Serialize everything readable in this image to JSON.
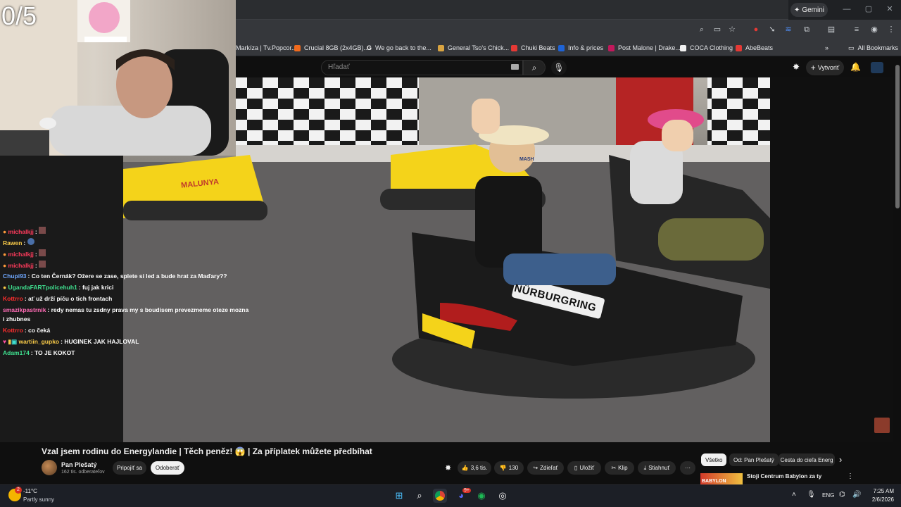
{
  "browser": {
    "gemini_label": "Gemini",
    "bookmarks": [
      {
        "label": "Markíza | Tv.Popcor...",
        "color": "#e8eaed"
      },
      {
        "label": "Crucial 8GB (2x4GB)...",
        "color": "#f06a1d"
      },
      {
        "label": "We go back to the...",
        "color": "#4285f4"
      },
      {
        "label": "General Tso's Chick...",
        "color": "#d9a441"
      },
      {
        "label": "Chuki Beats",
        "color": "#e53935"
      },
      {
        "label": "Info & prices",
        "color": "#1e63d6"
      },
      {
        "label": "Post Malone | Drake...",
        "color": "#c2185b"
      },
      {
        "label": "COCA Clothing",
        "color": "#f1f1f1"
      },
      {
        "label": "AbeBeats",
        "color": "#e53935"
      }
    ],
    "all_bookmarks_label": "All Bookmarks",
    "more_bookmarks_label": "»"
  },
  "youtube": {
    "search_placeholder": "Hľadať",
    "create_label": "Vytvoriť",
    "video_title": "Vzal jsem rodinu do Energylandie | Těch peněz! 😱 | Za příplatek můžete předbíhat",
    "channel_name": "Pan Plešatý",
    "subscribers": "162 tis. odberateľov",
    "join_label": "Pripojiť sa",
    "unsubscribe_label": "Odoberať",
    "likes": "3,6 tis.",
    "dislikes": "130",
    "share_label": "Zdieľať",
    "save_label": "Uložiť",
    "clip_label": "Klip",
    "download_label": "Stiahnuť",
    "more_label": "···",
    "chips": [
      "Všetko",
      "Od: Pan Plešatý",
      "Cesta do cieľa Energ"
    ],
    "chip_next": "›",
    "reco_title": "Stoji Centrum Babylon za ty",
    "reco_thumb_text": "BABYLON LIBEREC"
  },
  "stream": {
    "counter": "0/5",
    "chat": [
      {
        "name": "michalkjj",
        "name_color": "#ff3b5c",
        "message": ""
      },
      {
        "name": "Rawen",
        "name_color": "#f7c948",
        "message": ""
      },
      {
        "name": "michalkjj",
        "name_color": "#ff3b5c",
        "message": ""
      },
      {
        "name": "michalkjj",
        "name_color": "#ff3b5c",
        "message": ""
      },
      {
        "name": "Chupi93",
        "name_color": "#6fa8ff",
        "message": "Co ten Černák? Ožere se zase, splete si led a bude hrat za Maďary??"
      },
      {
        "name": "UgandaFARTpolicehuh1",
        "name_color": "#3fe08f",
        "message": "fuj jak krici"
      },
      {
        "name": "Kottrro",
        "name_color": "#ff2d2d",
        "message": "ať už drží píču o tich frontach"
      },
      {
        "name": "smazikpastrnik",
        "name_color": "#ff6bb5",
        "message": "redy nemas tu zsdny prava my s boudisem prevezmeme oteze mozna"
      },
      {
        "name": "",
        "name_color": "#ffffff",
        "message": "i zhubnes"
      },
      {
        "name": "Kottrro",
        "name_color": "#ff2d2d",
        "message": "co čeká"
      },
      {
        "name": "wartiin_gupko",
        "name_color": "#f7c948",
        "message": "HUGINEK JAK HAJLOVAL"
      },
      {
        "name": "Adam174",
        "name_color": "#3fe08f",
        "message": "TO JE KOKOT"
      }
    ]
  },
  "video_scene": {
    "car_labels": [
      "MALUNYA",
      "NÜRBURGRING",
      "MASH"
    ]
  },
  "taskbar": {
    "weather_temp": "-11°C",
    "weather_desc": "Partly sunny",
    "notification_badge": "2",
    "discord_badge": "9+",
    "language": "ENG",
    "time": "7:25 AM",
    "date": "2/6/2026"
  },
  "colors": {
    "yt_bg": "#0f0f0f",
    "chrome_toolbar": "#35373b",
    "taskbar": "#1c1f26"
  }
}
